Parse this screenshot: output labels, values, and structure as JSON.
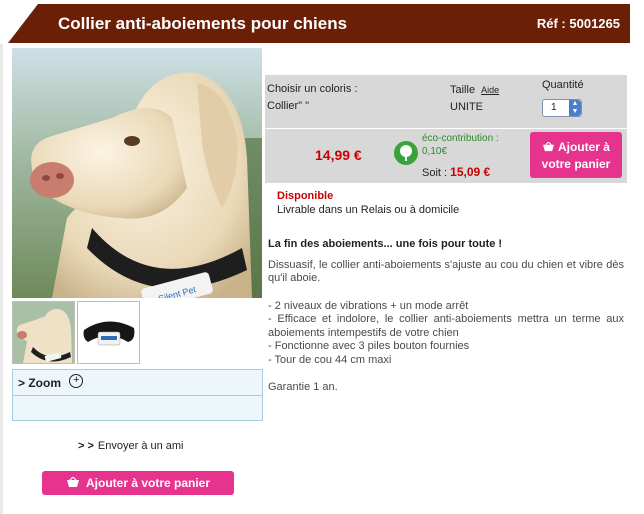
{
  "header": {
    "title": "Collier anti-aboiements pour chiens",
    "ref": "Réf : 5001265"
  },
  "options": {
    "color_label": "Choisir un coloris :",
    "color_value": "Collier\" \"",
    "size_label": "Taille",
    "size_help": "Aide",
    "size_value": "UNITE",
    "qty_label": "Quantité",
    "qty_value": "1"
  },
  "pricing": {
    "price": "14,99 €",
    "eco_label": "éco-contribution :",
    "eco_value": "0,10€",
    "total_label": "Soit :",
    "total_value": "15,09 €",
    "add_cart_line1": "Ajouter à",
    "add_cart_line2": "votre panier"
  },
  "availability": {
    "status": "Disponible",
    "delivery": "Livrable dans un Relais ou à domicile"
  },
  "description": {
    "heading": "La fin des aboiements... une fois pour toute !",
    "intro": "Dissuasif, le collier anti-aboiements s'ajuste au cou du chien et vibre dès qu'il aboie.",
    "bullets": [
      "- 2 niveaux de vibrations + un mode arrêt",
      "- Efficace et indolore, le collier anti-aboiements mettra un terme aux aboiements intempestifs de votre chien",
      "- Fonctionne avec 3 piles bouton fournies",
      "- Tour de cou 44 cm maxi"
    ],
    "warranty": "Garantie 1 an."
  },
  "gallery": {
    "zoom_label": "> Zoom",
    "collar_brand": "Silent Pet"
  },
  "actions": {
    "send_prefix": "> >",
    "send_friend": "Envoyer à un ami",
    "add_cart_bottom": "Ajouter à votre panier"
  },
  "colors": {
    "header_bg": "#6b1f06",
    "cart_pink": "#e6338d",
    "price_red": "#cc0000",
    "eco_green": "#39a23a",
    "option_bg": "#d8d8d8"
  }
}
